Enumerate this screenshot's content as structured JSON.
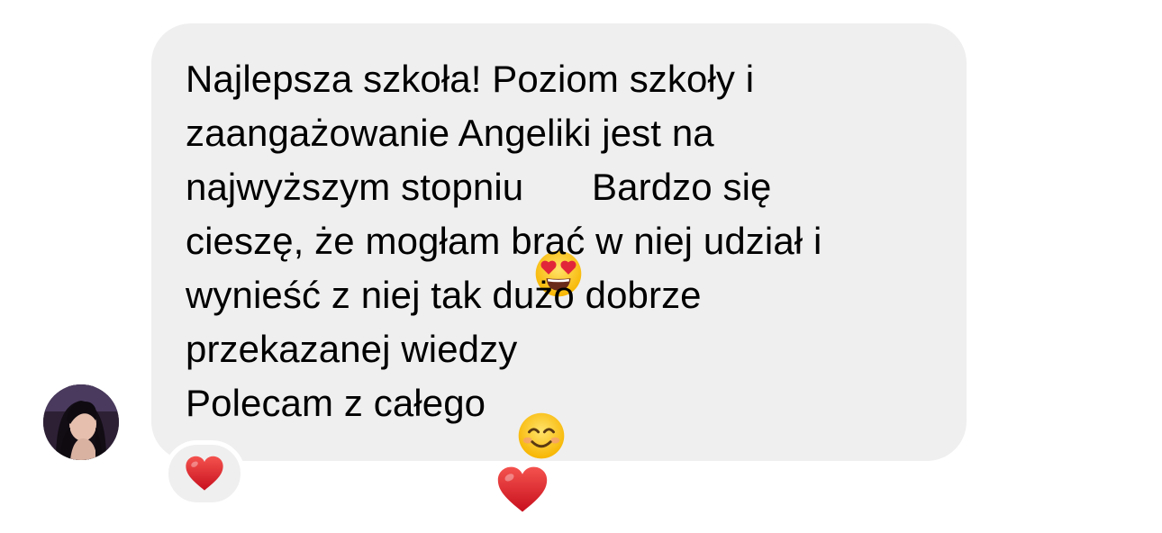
{
  "message": {
    "lines": [
      [
        "Najlepsza szkoła! Poziom szkoły i"
      ],
      [
        "zaangażowanie Angeliki jest na"
      ],
      [
        "najwyższym stopniu ",
        "Bardzo się"
      ],
      [
        "cieszę, że mogłam brać w niej udział i"
      ],
      [
        "wynieść z niej tak dużo dobrze"
      ],
      [
        "przekazanej wiedzy"
      ],
      [
        "Polecam z całego "
      ]
    ],
    "emojis": [
      "heart-eyes-emoji",
      "smiling-face-emoji",
      "red-heart-emoji"
    ]
  },
  "reaction": {
    "emoji": "red-heart-emoji"
  },
  "colors": {
    "bubble": "#efefef",
    "text": "#000000",
    "heart": "#e0262f"
  }
}
